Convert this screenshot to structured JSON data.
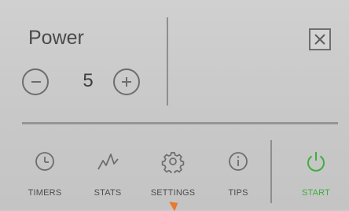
{
  "power": {
    "title": "Power",
    "value": "5",
    "decrement_icon": "minus-circle-icon",
    "increment_icon": "plus-circle-icon"
  },
  "close_icon": "close-x-icon",
  "nav": {
    "items": [
      {
        "label": "TIMERS",
        "icon": "clock-icon"
      },
      {
        "label": "STATS",
        "icon": "zigzag-chart-icon"
      },
      {
        "label": "SETTINGS",
        "icon": "gear-icon"
      },
      {
        "label": "TIPS",
        "icon": "info-icon"
      }
    ],
    "start": {
      "label": "START",
      "icon": "power-icon"
    }
  },
  "colors": {
    "background": "#c9c9c9",
    "icon": "#6d6d6d",
    "start_accent": "#3fae3f",
    "pointer": "#e67a2e"
  }
}
